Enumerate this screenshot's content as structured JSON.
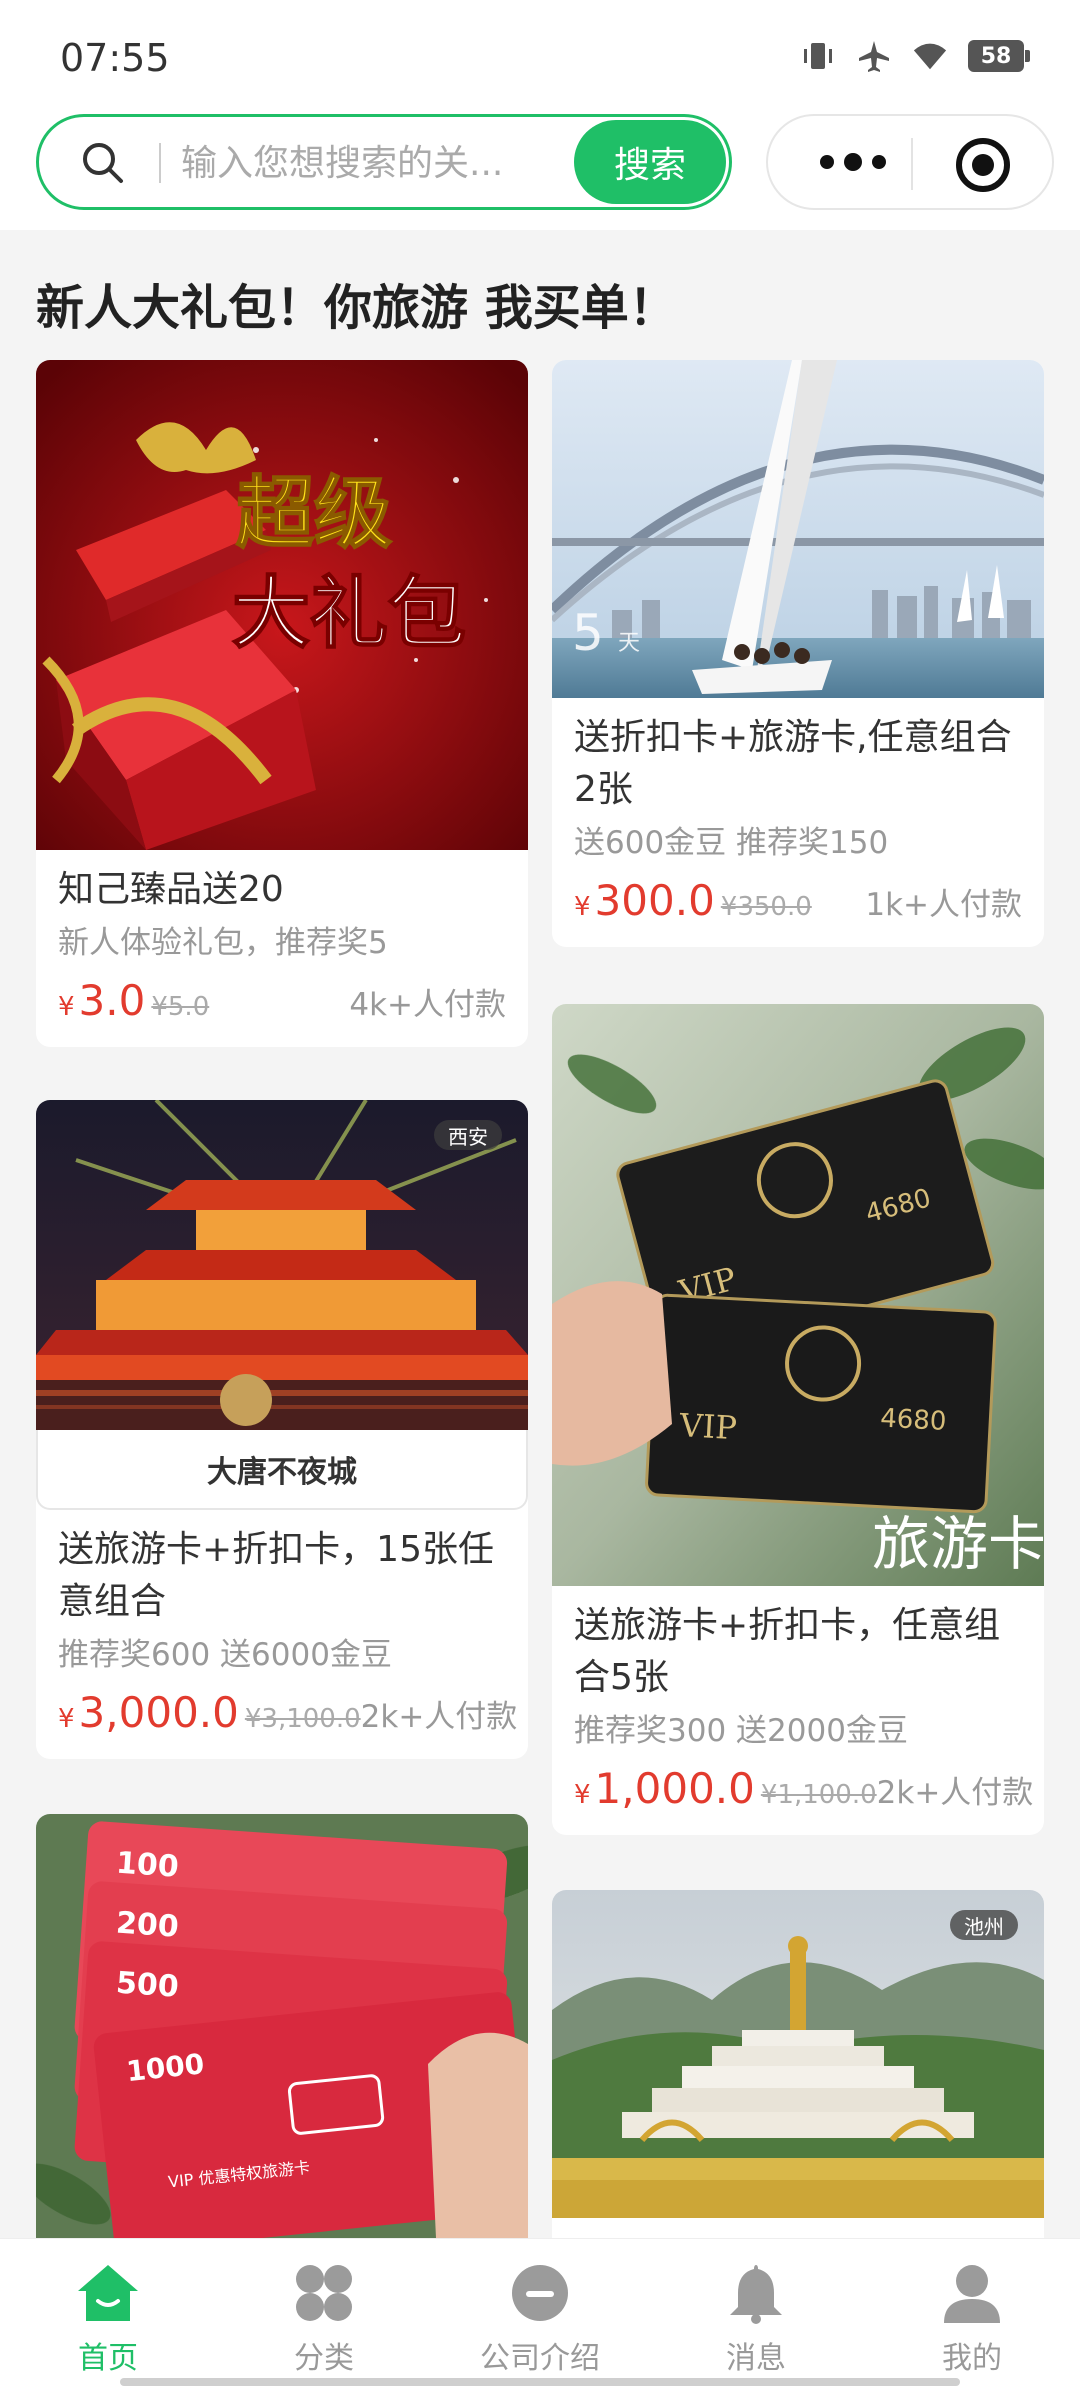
{
  "status_bar": {
    "time": "07:55",
    "battery": "58"
  },
  "search": {
    "placeholder": "输入您想搜索的关...",
    "button": "搜索"
  },
  "section": {
    "title": "新人大礼包！你旅游 我买单！"
  },
  "cards": {
    "gift": {
      "image_text_line1": "超级",
      "image_text_line2": "大礼包",
      "title": "知己臻品送20",
      "subtitle": "新人体验礼包，推荐奖5",
      "currency": "¥",
      "price": "3.0",
      "old_price": "¥5.0",
      "sales": "4k+人付款"
    },
    "sailing": {
      "overlay": "5",
      "overlay_unit": "天",
      "title": "送折扣卡+旅游卡,任意组合2张",
      "subtitle": "送600金豆 推荐奖150",
      "currency": "¥",
      "price": "300.0",
      "old_price": "¥350.0",
      "sales": "1k+人付款"
    },
    "datang": {
      "tag": "西安",
      "caption": "大唐不夜城",
      "title": "送旅游卡+折扣卡，15张任意组合",
      "subtitle": "推荐奖600 送6000金豆",
      "currency": "¥",
      "price": "3,000.0",
      "old_price": "¥3,100.0",
      "sales": "2k+人付款"
    },
    "vip": {
      "card_text": "VIP",
      "card_number": "4680",
      "watermark": "旅游卡",
      "title": "送旅游卡+折扣卡，任意组合5张",
      "subtitle": "推荐奖300 送2000金豆",
      "currency": "¥",
      "price": "1,000.0",
      "old_price": "¥1,100.0",
      "sales": "2k+人付款"
    },
    "redcards": {
      "values": [
        "100",
        "200",
        "500",
        "1000"
      ],
      "footer_text": "VIP 优惠特权旅游卡"
    },
    "chizhou": {
      "tag": "池州"
    }
  },
  "tabbar": [
    {
      "label": "首页",
      "icon": "home-icon"
    },
    {
      "label": "分类",
      "icon": "category-icon"
    },
    {
      "label": "公司介绍",
      "icon": "company-icon"
    },
    {
      "label": "消息",
      "icon": "bell-icon"
    },
    {
      "label": "我的",
      "icon": "user-icon"
    }
  ],
  "colors": {
    "accent": "#1fbf67",
    "price": "#e23b2e"
  }
}
